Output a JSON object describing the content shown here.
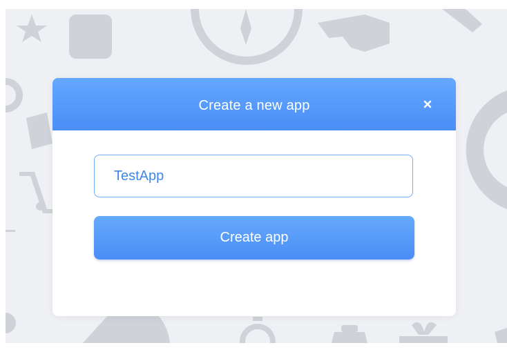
{
  "modal": {
    "title": "Create a new app",
    "close_icon": "close-icon"
  },
  "form": {
    "app_name_value": "TestApp",
    "create_button_label": "Create app"
  },
  "colors": {
    "header_accent": "#4a8ef7",
    "button_accent": "#5a9cf9",
    "input_border": "#72adf7",
    "input_text": "#3f87e6",
    "backdrop": "#eef0f4",
    "background_icons": "#cfd2d8"
  },
  "background_icons": [
    "star-icon",
    "quote-icon",
    "compass-icon",
    "megaphone-icon",
    "phone-icon",
    "ticket-icon",
    "shopping-cart-icon",
    "pie-chart-icon",
    "stopwatch-icon",
    "clipboard-icon",
    "gift-icon",
    "ring-icon"
  ]
}
